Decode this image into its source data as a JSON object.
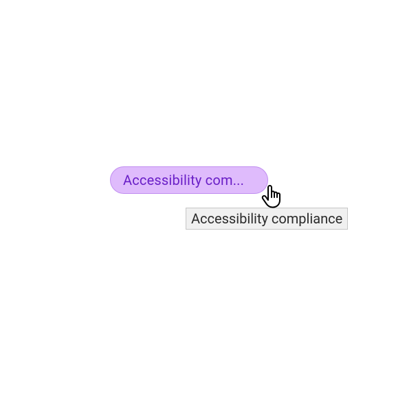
{
  "tag": {
    "truncated_label": "Accessibility com...",
    "full_label": "Accessibility compliance",
    "bg_color": "#dfbbfc",
    "border_color": "#c08ef0",
    "text_color": "#6a1fc7"
  },
  "tooltip": {
    "text": "Accessibility compliance"
  }
}
